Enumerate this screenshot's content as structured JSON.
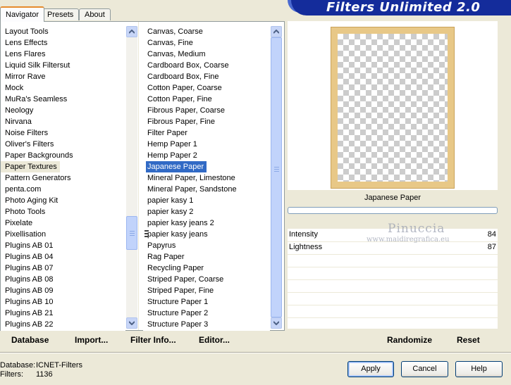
{
  "tabs": [
    "Navigator",
    "Presets",
    "About"
  ],
  "banner_title": "Filters Unlimited 2.0",
  "categories": [
    "Layout Tools",
    "Lens Effects",
    "Lens Flares",
    "Liquid Silk Filtersut",
    "Mirror Rave",
    "Mock",
    "MuRa's Seamless",
    "Neology",
    "Nirvana",
    "Noise Filters",
    "Oliver's Filters",
    "Paper Backgrounds",
    "Paper Textures",
    "Pattern Generators",
    "penta.com",
    "Photo Aging Kit",
    "Photo Tools",
    "Pixelate",
    "Pixellisation",
    "Plugins AB 01",
    "Plugins AB 04",
    "Plugins AB 07",
    "Plugins AB 08",
    "Plugins AB 09",
    "Plugins AB 10",
    "Plugins AB 21",
    "Plugins AB 22"
  ],
  "selected_category": "Paper Textures",
  "filters": [
    "Canvas, Coarse",
    "Canvas, Fine",
    "Canvas, Medium",
    "Cardboard Box, Coarse",
    "Cardboard Box, Fine",
    "Cotton Paper, Coarse",
    "Cotton Paper, Fine",
    "Fibrous Paper, Coarse",
    "Fibrous Paper, Fine",
    "Filter Paper",
    "Hemp Paper 1",
    "Hemp Paper 2",
    "Japanese Paper",
    "Mineral Paper, Limestone",
    "Mineral Paper, Sandstone",
    "papier kasy 1",
    "papier kasy 2",
    "papier kasy jeans 2",
    "papier kasy jeans",
    "Papyrus",
    "Rag Paper",
    "Recycling Paper",
    "Striped Paper, Coarse",
    "Striped Paper, Fine",
    "Structure Paper 1",
    "Structure Paper 2",
    "Structure Paper 3"
  ],
  "selected_filter": "Japanese Paper",
  "preview": {
    "filter_name": "Japanese Paper"
  },
  "sliders": [
    {
      "label": "Intensity",
      "value": "84"
    },
    {
      "label": "Lightness",
      "value": "87"
    }
  ],
  "watermark": {
    "line1": "Pinuccia",
    "line2": "www.maidiregrafica.eu"
  },
  "actions": {
    "database": "Database",
    "import": "Import...",
    "filter_info": "Filter Info...",
    "editor": "Editor...",
    "randomize": "Randomize",
    "reset": "Reset"
  },
  "status": {
    "database_label": "Database:",
    "database_value": "ICNET-Filters",
    "filters_label": "Filters:",
    "filters_value": "1136"
  },
  "buttons": {
    "apply": "Apply",
    "cancel": "Cancel",
    "help": "Help"
  }
}
